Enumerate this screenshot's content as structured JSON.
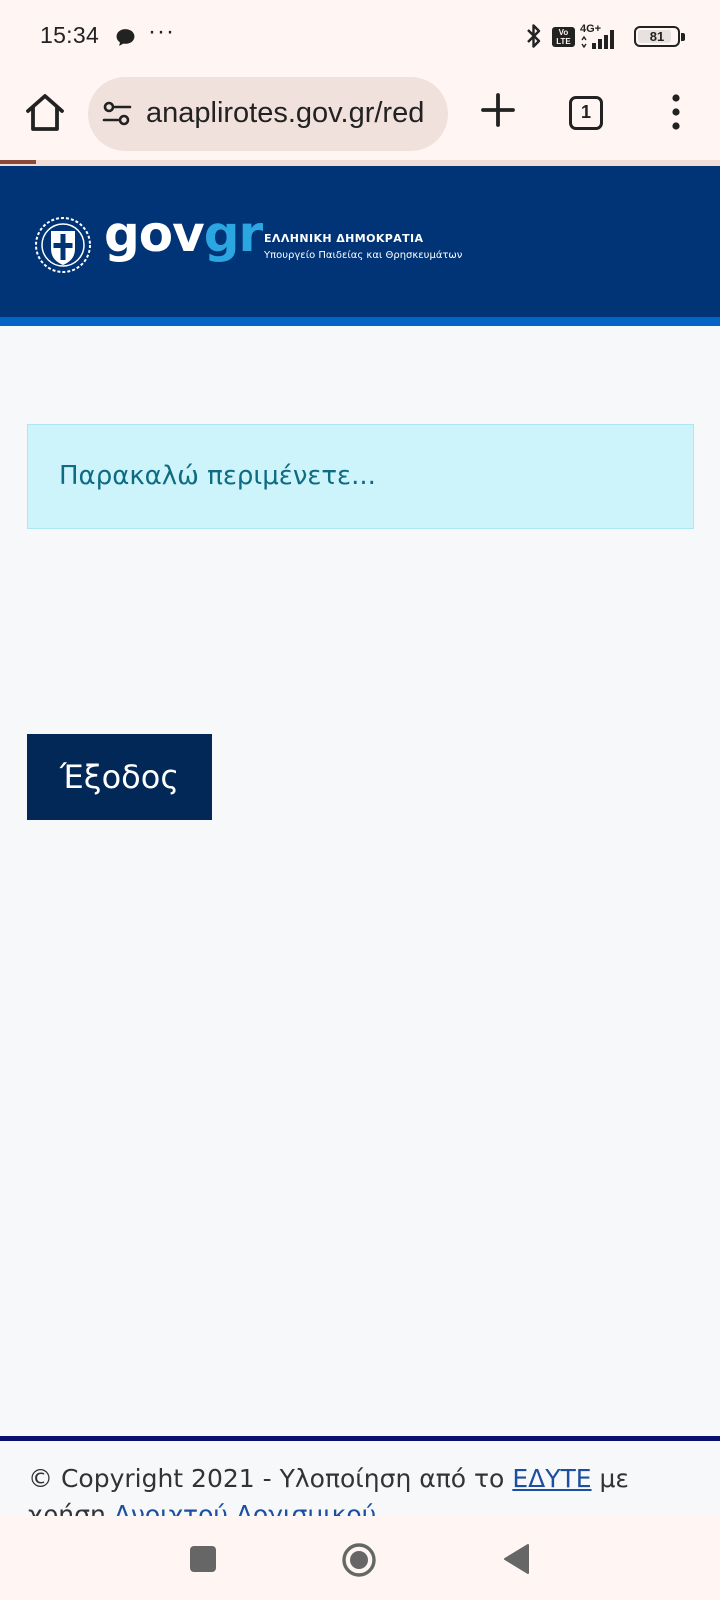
{
  "status_bar": {
    "time": "15:34",
    "more_indicator": "···",
    "network_label": "4G+",
    "volte_label": "Vo LTE",
    "battery_level": "81",
    "icons": [
      "chat-bubble-icon",
      "bluetooth-icon",
      "volte-icon",
      "signal-icon",
      "battery-icon"
    ]
  },
  "browser": {
    "url": "anaplirotes.gov.gr/red",
    "tab_count": "1",
    "page_load_progress": 0.05,
    "icons": [
      "home-icon",
      "site-settings-icon",
      "plus-icon",
      "tabs-icon",
      "overflow-menu-icon"
    ]
  },
  "header": {
    "logo_gov": "gov",
    "logo_gr": "gr",
    "republic": "ΕΛΛΗΝΙΚΗ ΔΗΜΟΚΡΑΤΙΑ",
    "ministry": "Υπουργείο Παιδείας και Θρησκευμάτων"
  },
  "main": {
    "loading_message": "Παρακαλώ περιμένετε...",
    "exit_button": "Έξοδος"
  },
  "footer": {
    "copyright_prefix": "© Copyright 2021 - Υλοποίηση από το ",
    "edyte_link": "ΕΔΥΤΕ",
    "middle": " με χρήση ",
    "open_software_link": "Ανοιχτού Λογισμικού"
  },
  "nav_bar": {
    "icons": [
      "recents-square-icon",
      "home-circle-icon",
      "back-triangle-icon"
    ]
  },
  "colors": {
    "status_bg": "#fff5f2",
    "gov_blue": "#003476",
    "gov_accent": "#0065c7",
    "alert_bg": "#cef4fb",
    "alert_text": "#0e6b84",
    "exit_button_bg": "#022858",
    "footer_rule": "#0b0f6e",
    "link": "#1c4fa1"
  }
}
